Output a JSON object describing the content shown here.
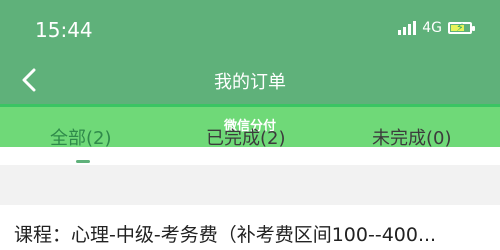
{
  "status": {
    "time": "15:44",
    "network": "4G",
    "battery_level": 0.7
  },
  "nav": {
    "title": "我的订单"
  },
  "banner": {
    "label": "微信分付"
  },
  "tabs": [
    {
      "label": "全部(2)"
    },
    {
      "label": "已完成(2)"
    },
    {
      "label": "未完成(0)"
    }
  ],
  "order": {
    "course": "课程：心理-中级-考务费（补考费区间100--400..."
  },
  "colors": {
    "header_green": "#5fb17a",
    "banner_green": "#6fd978",
    "active_tab": "#2f8a4a"
  }
}
